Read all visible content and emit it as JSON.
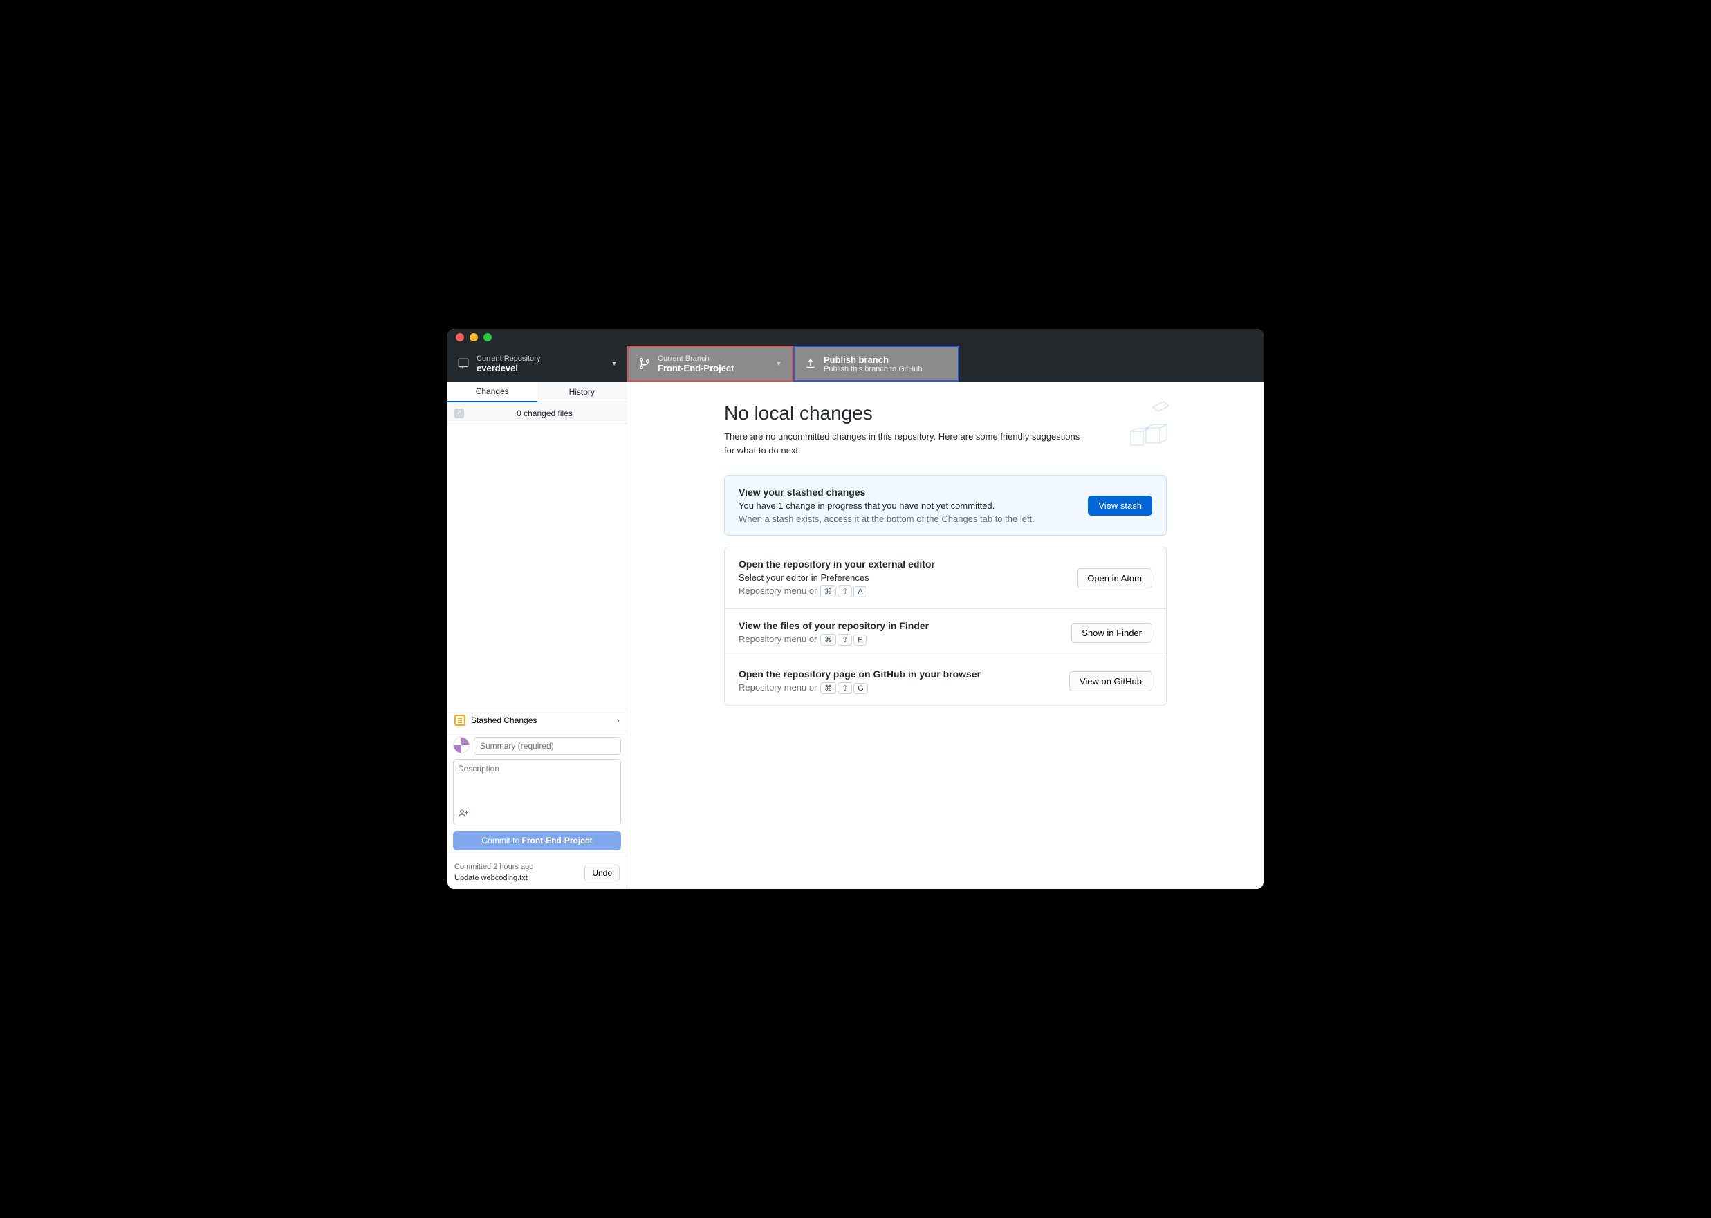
{
  "toolbar": {
    "repo": {
      "label": "Current Repository",
      "value": "everdevel"
    },
    "branch": {
      "label": "Current Branch",
      "value": "Front-End-Project"
    },
    "publish": {
      "label": "Publish branch",
      "value": "Publish this branch to GitHub"
    }
  },
  "tabs": {
    "changes": "Changes",
    "history": "History"
  },
  "changed_files": "0 changed files",
  "stashed_row": "Stashed Changes",
  "commit": {
    "summary_placeholder": "Summary (required)",
    "desc_placeholder": "Description",
    "button_prefix": "Commit to ",
    "button_branch": "Front-End-Project"
  },
  "last_commit": {
    "time": "Committed 2 hours ago",
    "message": "Update webcoding.txt",
    "undo": "Undo"
  },
  "main": {
    "heading": "No local changes",
    "sub": "There are no uncommitted changes in this repository. Here are some friendly suggestions for what to do next."
  },
  "stash_card": {
    "title": "View your stashed changes",
    "line": "You have 1 change in progress that you have not yet committed.",
    "hint": "When a stash exists, access it at the bottom of the Changes tab to the left.",
    "button": "View stash"
  },
  "editor_card": {
    "title": "Open the repository in your external editor",
    "line_prefix": "Select your editor in ",
    "link": "Preferences",
    "menu": "Repository menu or ",
    "keys": [
      "⌘",
      "⇧",
      "A"
    ],
    "button": "Open in Atom"
  },
  "finder_card": {
    "title": "View the files of your repository in Finder",
    "menu": "Repository menu or ",
    "keys": [
      "⌘",
      "⇧",
      "F"
    ],
    "button": "Show in Finder"
  },
  "github_card": {
    "title": "Open the repository page on GitHub in your browser",
    "menu": "Repository menu or ",
    "keys": [
      "⌘",
      "⇧",
      "G"
    ],
    "button": "View on GitHub"
  }
}
